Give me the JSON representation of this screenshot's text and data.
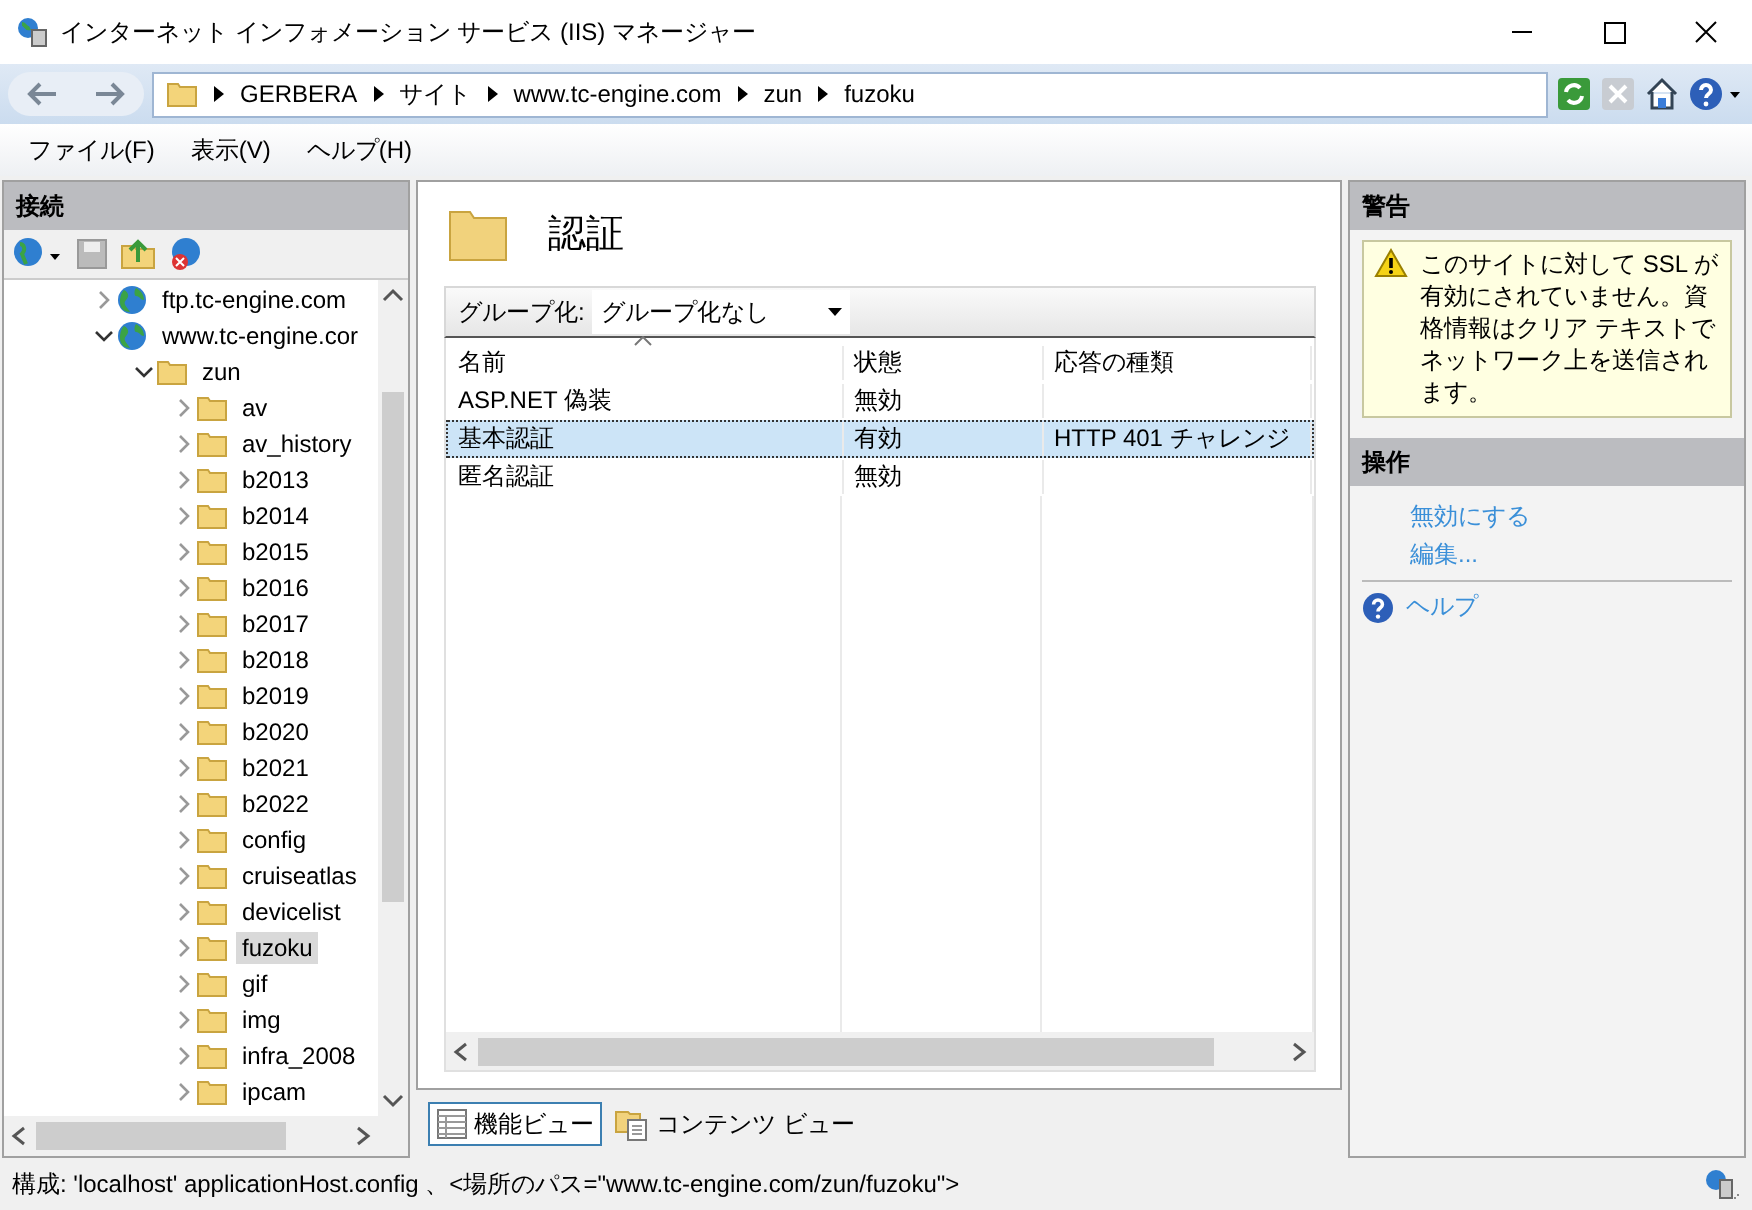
{
  "window": {
    "title": "インターネット インフォメーション サービス (IIS) マネージャー"
  },
  "address": {
    "crumbs": [
      "GERBERA",
      "サイト",
      "www.tc-engine.com",
      "zun",
      "fuzoku"
    ]
  },
  "menu": [
    "ファイル(F)",
    "表示(V)",
    "ヘルプ(H)"
  ],
  "connections": {
    "title": "接続",
    "tree": [
      {
        "label": "ftp.tc-engine.com",
        "kind": "site",
        "expanded": false,
        "selected": false
      },
      {
        "label": "www.tc-engine.cor",
        "kind": "site",
        "expanded": true,
        "selected": false,
        "children": [
          {
            "label": "zun",
            "kind": "folder",
            "expanded": true,
            "selected": false,
            "children": [
              {
                "label": "av",
                "kind": "folder",
                "expanded": false,
                "selected": false
              },
              {
                "label": "av_history",
                "kind": "folder",
                "expanded": false,
                "selected": false
              },
              {
                "label": "b2013",
                "kind": "folder",
                "expanded": false,
                "selected": false
              },
              {
                "label": "b2014",
                "kind": "folder",
                "expanded": false,
                "selected": false
              },
              {
                "label": "b2015",
                "kind": "folder",
                "expanded": false,
                "selected": false
              },
              {
                "label": "b2016",
                "kind": "folder",
                "expanded": false,
                "selected": false
              },
              {
                "label": "b2017",
                "kind": "folder",
                "expanded": false,
                "selected": false
              },
              {
                "label": "b2018",
                "kind": "folder",
                "expanded": false,
                "selected": false
              },
              {
                "label": "b2019",
                "kind": "folder",
                "expanded": false,
                "selected": false
              },
              {
                "label": "b2020",
                "kind": "folder",
                "expanded": false,
                "selected": false
              },
              {
                "label": "b2021",
                "kind": "folder",
                "expanded": false,
                "selected": false
              },
              {
                "label": "b2022",
                "kind": "folder",
                "expanded": false,
                "selected": false
              },
              {
                "label": "config",
                "kind": "folder",
                "expanded": false,
                "selected": false
              },
              {
                "label": "cruiseatlas",
                "kind": "folder",
                "expanded": false,
                "selected": false
              },
              {
                "label": "devicelist",
                "kind": "folder",
                "expanded": false,
                "selected": false
              },
              {
                "label": "fuzoku",
                "kind": "folder",
                "expanded": false,
                "selected": true
              },
              {
                "label": "gif",
                "kind": "folder",
                "expanded": false,
                "selected": false
              },
              {
                "label": "img",
                "kind": "folder",
                "expanded": false,
                "selected": false
              },
              {
                "label": "infra_2008",
                "kind": "folder",
                "expanded": false,
                "selected": false
              },
              {
                "label": "ipcam",
                "kind": "folder",
                "expanded": false,
                "selected": false
              }
            ]
          }
        ]
      }
    ]
  },
  "features": {
    "title": "認証",
    "group_label": "グループ化:",
    "group_value": "グループ化なし",
    "columns": [
      "名前",
      "状態",
      "応答の種類"
    ],
    "rows": [
      {
        "cells": [
          "ASP.NET 偽装",
          "無効",
          ""
        ],
        "selected": false
      },
      {
        "cells": [
          "基本認証",
          "有効",
          "HTTP 401 チャレンジ"
        ],
        "selected": true
      },
      {
        "cells": [
          "匿名認証",
          "無効",
          ""
        ],
        "selected": false
      }
    ],
    "view_tabs": [
      {
        "label": "機能ビュー",
        "kind": "features",
        "selected": true
      },
      {
        "label": "コンテンツ ビュー",
        "kind": "content",
        "selected": false
      }
    ]
  },
  "alerts": {
    "title": "警告",
    "message": "このサイトに対して SSL が有効にされていません。資格情報はクリア テキストでネットワーク上を送信されます。"
  },
  "actions": {
    "title": "操作",
    "items": [
      {
        "label": "無効にする",
        "kind": "link"
      },
      {
        "label": "編集...",
        "kind": "link"
      },
      {
        "label": "ヘルプ",
        "kind": "help"
      }
    ]
  },
  "status_bar": {
    "text": "構成: 'localhost' applicationHost.config 、<場所のパス=\"www.tc-engine.com/zun/fuzoku\">"
  }
}
